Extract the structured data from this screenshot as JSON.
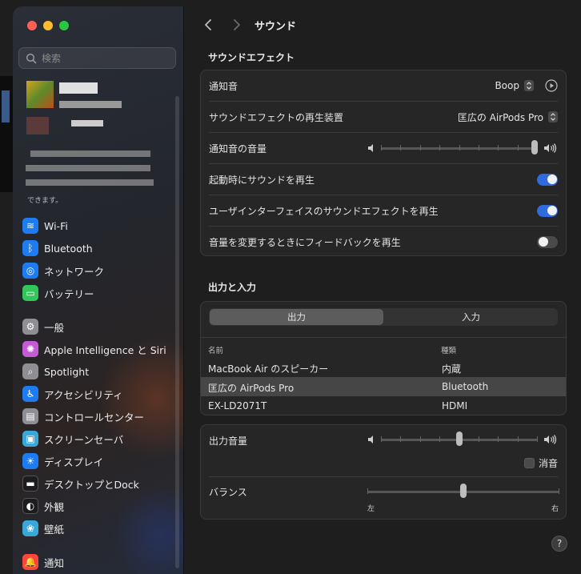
{
  "window": {
    "title": "サウンド"
  },
  "sidebar": {
    "search_placeholder": "検索",
    "profile_note": "できます。",
    "items": [
      {
        "label": "Wi-Fi",
        "icon": "wifi-icon",
        "color": "#1e7cf2"
      },
      {
        "label": "Bluetooth",
        "icon": "bluetooth-icon",
        "color": "#1e7cf2"
      },
      {
        "label": "ネットワーク",
        "icon": "globe-icon",
        "color": "#1e7cf2"
      },
      {
        "label": "バッテリー",
        "icon": "battery-icon",
        "color": "#32c759"
      },
      {
        "label": "一般",
        "icon": "gear-icon",
        "color": "#8e8e93"
      },
      {
        "label": "Apple Intelligence と Siri",
        "icon": "siri-icon",
        "color": "#c25bd4"
      },
      {
        "label": "Spotlight",
        "icon": "magnifier-icon",
        "color": "#8e8e93"
      },
      {
        "label": "アクセシビリティ",
        "icon": "accessibility-icon",
        "color": "#1e7cf2"
      },
      {
        "label": "コントロールセンター",
        "icon": "control-center-icon",
        "color": "#8e8e93"
      },
      {
        "label": "スクリーンセーバ",
        "icon": "screensaver-icon",
        "color": "#3aa7d8"
      },
      {
        "label": "ディスプレイ",
        "icon": "sun-icon",
        "color": "#1e7cf2"
      },
      {
        "label": "デスクトップとDock",
        "icon": "dock-icon",
        "color": "#1c1c1e"
      },
      {
        "label": "外観",
        "icon": "appearance-icon",
        "color": "#1c1c1e"
      },
      {
        "label": "壁紙",
        "icon": "wallpaper-icon",
        "color": "#3aa7d8"
      },
      {
        "label": "通知",
        "icon": "notification-icon",
        "color": "#ff453a"
      }
    ]
  },
  "sound_effects": {
    "section_title": "サウンドエフェクト",
    "alert_sound": {
      "label": "通知音",
      "value": "Boop"
    },
    "output_device": {
      "label": "サウンドエフェクトの再生装置",
      "value": "匡広の AirPods Pro"
    },
    "alert_volume": {
      "label": "通知音の音量",
      "level": 1.0
    },
    "startup_sound": {
      "label": "起動時にサウンドを再生",
      "on": true
    },
    "ui_sound": {
      "label": "ユーザインターフェイスのサウンドエフェクトを再生",
      "on": true
    },
    "volume_feedback": {
      "label": "音量を変更するときにフィードバックを再生",
      "on": false
    }
  },
  "io": {
    "section_title": "出力と入力",
    "tabs": [
      "出力",
      "入力"
    ],
    "active_tab": 0,
    "columns": [
      "名前",
      "種類"
    ],
    "devices": [
      {
        "name": "MacBook Air のスピーカー",
        "type": "内蔵",
        "selected": false
      },
      {
        "name": "匡広の AirPods Pro",
        "type": "Bluetooth",
        "selected": true
      },
      {
        "name": "EX-LD2071T",
        "type": "HDMI",
        "selected": false
      }
    ]
  },
  "output_volume": {
    "label": "出力音量",
    "level": 0.5,
    "mute_label": "消音",
    "muted": false
  },
  "balance": {
    "label": "バランス",
    "level": 0.5,
    "left_label": "左",
    "right_label": "右"
  },
  "help_label": "?"
}
